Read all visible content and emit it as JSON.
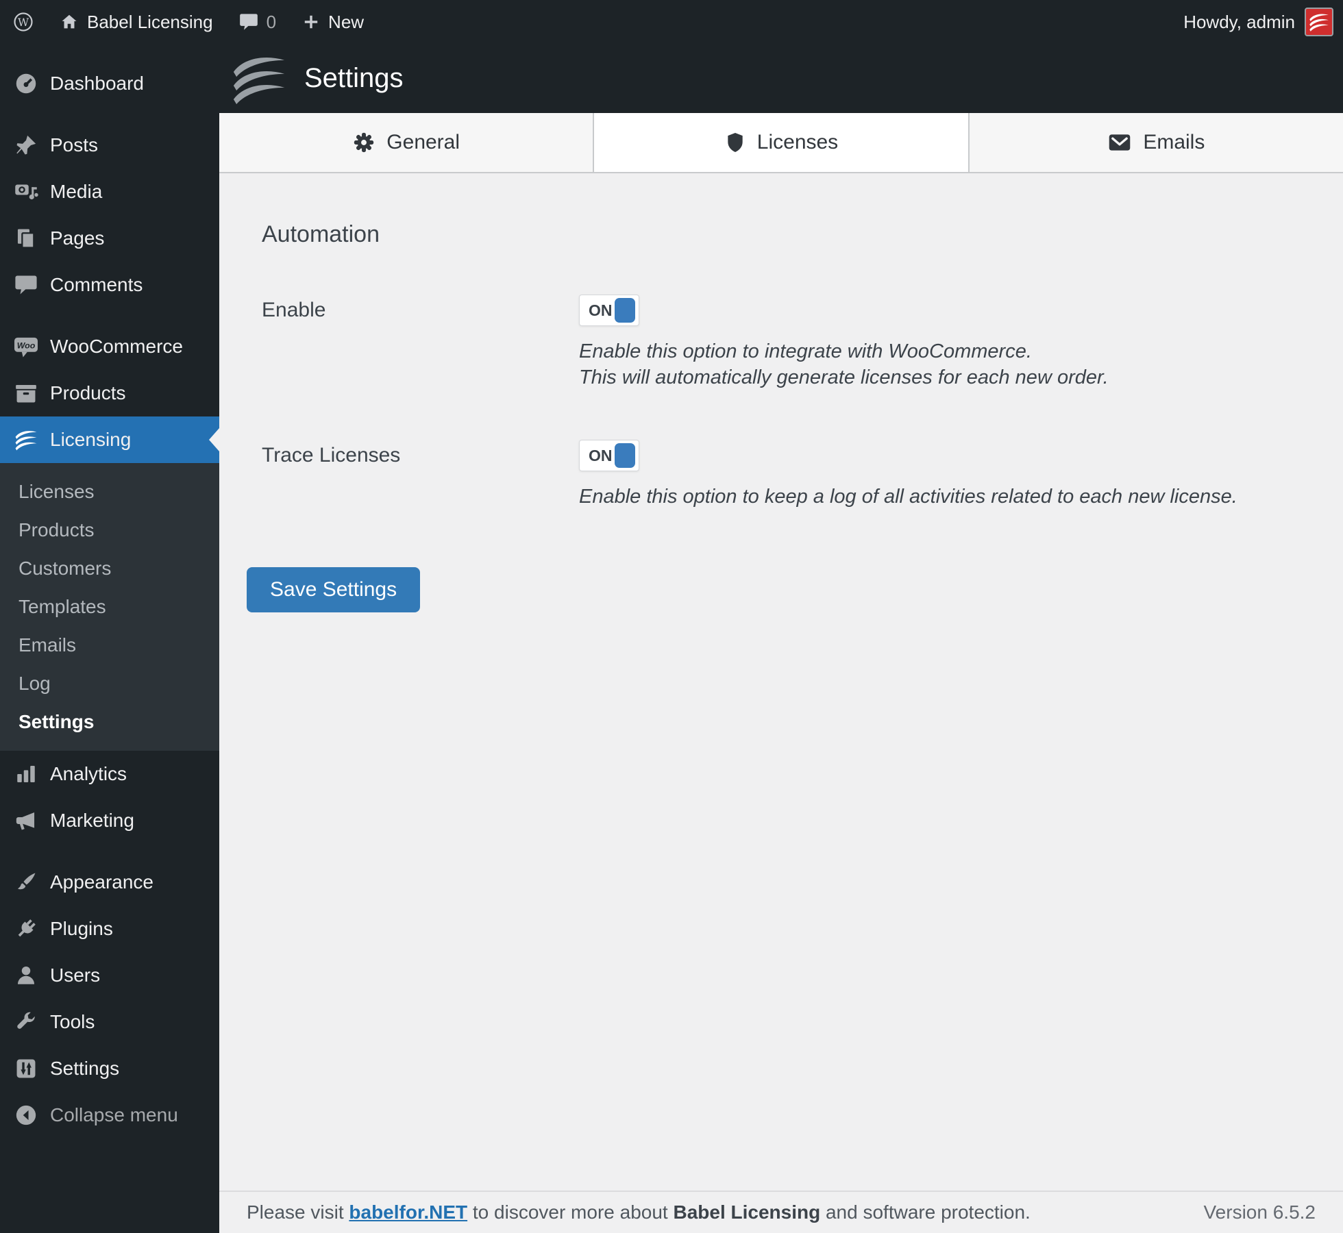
{
  "admin_bar": {
    "site_name": "Babel Licensing",
    "comments_count": "0",
    "new_label": "New",
    "howdy": "Howdy, admin"
  },
  "sidebar": {
    "items": {
      "dashboard": "Dashboard",
      "posts": "Posts",
      "media": "Media",
      "pages": "Pages",
      "comments": "Comments",
      "woocommerce": "WooCommerce",
      "products": "Products",
      "licensing": "Licensing",
      "analytics": "Analytics",
      "marketing": "Marketing",
      "appearance": "Appearance",
      "plugins": "Plugins",
      "users": "Users",
      "tools": "Tools",
      "settings": "Settings",
      "collapse": "Collapse menu"
    },
    "licensing_submenu": [
      "Licenses",
      "Products",
      "Customers",
      "Templates",
      "Emails",
      "Log",
      "Settings"
    ],
    "active_item": "Licensing",
    "current_submenu_item": "Settings"
  },
  "header": {
    "title": "Settings"
  },
  "tabs": [
    {
      "label": "General",
      "active": false
    },
    {
      "label": "Licenses",
      "active": true
    },
    {
      "label": "Emails",
      "active": false
    }
  ],
  "content": {
    "section_title": "Automation",
    "settings": [
      {
        "label": "Enable",
        "toggle_label": "ON",
        "toggle_state": "on",
        "description_line1": "Enable this option to integrate with WooCommerce.",
        "description_line2": "This will automatically generate licenses for each new order."
      },
      {
        "label": "Trace Licenses",
        "toggle_label": "ON",
        "toggle_state": "on",
        "description_line1": "Enable this option to keep a log of all activities related to each new license."
      }
    ],
    "save_button_label": "Save Settings"
  },
  "footer": {
    "prefix": "Please visit ",
    "link": "babelfor.NET",
    "mid": " to discover more about ",
    "brand": "Babel Licensing",
    "suffix": " and software protection.",
    "version": "Version 6.5.2"
  },
  "colors": {
    "active_menu_blue": "#2471b3",
    "button_blue": "#337ab7",
    "toggle_knob_blue": "#3a7cbd",
    "link_blue": "#2271b1",
    "avatar_red": "#cf2e2e",
    "sidebar_bg": "#1d2327",
    "submenu_bg": "#2c3338",
    "content_bg": "#f0f0f1"
  }
}
